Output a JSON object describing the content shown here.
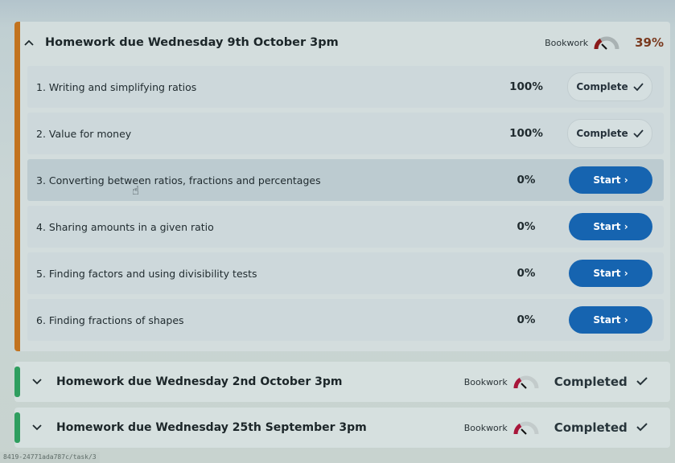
{
  "homeworks": [
    {
      "title": "Homework due Wednesday 9th October 3pm",
      "expanded": true,
      "bookwork_label": "Bookwork",
      "progress_text": "39%",
      "accent_color": "#c2731f",
      "tasks": [
        {
          "name": "1. Writing and simplifying ratios",
          "percent": "100%",
          "action": "Complete",
          "action_icon": "✓"
        },
        {
          "name": "2. Value for money",
          "percent": "100%",
          "action": "Complete",
          "action_icon": "✓"
        },
        {
          "name": "3. Converting between ratios, fractions and percentages",
          "percent": "0%",
          "action": "Start",
          "action_icon": "›"
        },
        {
          "name": "4. Sharing amounts in a given ratio",
          "percent": "0%",
          "action": "Start",
          "action_icon": "›"
        },
        {
          "name": "5. Finding factors and using divisibility tests",
          "percent": "0%",
          "action": "Start",
          "action_icon": "›"
        },
        {
          "name": "6. Finding fractions of shapes",
          "percent": "0%",
          "action": "Start",
          "action_icon": "›"
        }
      ]
    },
    {
      "title": "Homework due Wednesday 2nd October 3pm",
      "expanded": false,
      "bookwork_label": "Bookwork",
      "status": "Completed",
      "status_icon": "✓",
      "accent_color": "#2f9e5f"
    },
    {
      "title": "Homework due Wednesday 25th September 3pm",
      "expanded": false,
      "bookwork_label": "Bookwork",
      "status": "Completed",
      "status_icon": "✓",
      "accent_color": "#2f9e5f"
    }
  ],
  "icons": {
    "collapse": "^",
    "expand": "⌄",
    "pointer": "☝"
  },
  "colors": {
    "start_button": "#1664b0",
    "progress_text": "#7a3a1f",
    "bookwork_gauge": "#8b1a1a"
  },
  "status_bar_url": "8419-24771ada787c/task/3"
}
